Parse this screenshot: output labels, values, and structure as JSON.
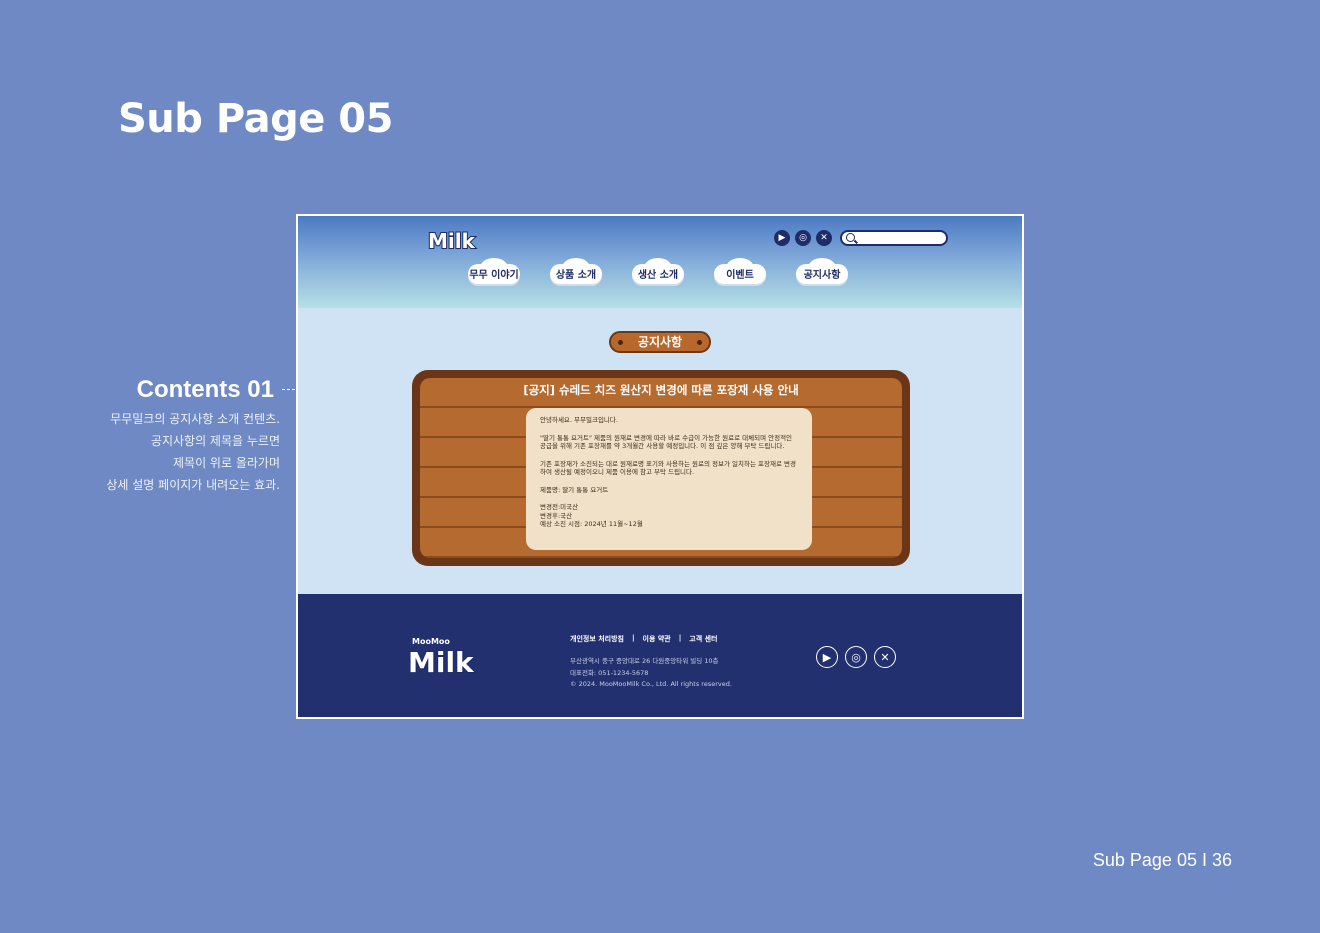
{
  "page": {
    "title": "Sub Page 05",
    "footer_label": "Sub Page 05 I 36"
  },
  "annotation": {
    "title": "Contents 01",
    "lines": [
      "무무밀크의 공지사항 소개 컨텐츠.",
      "공지사항의 제목을 누르면",
      "제목이 위로 올라가며",
      "상세 설명 페이지가 내려오는 효과."
    ]
  },
  "site": {
    "logo_text": "Milk",
    "nav": [
      "무무 이야기",
      "상품 소개",
      "생산 소개",
      "이벤트",
      "공지사항"
    ],
    "search_placeholder": "",
    "social": [
      "youtube-icon",
      "instagram-icon",
      "x-icon"
    ]
  },
  "notice": {
    "sign": "공지사항",
    "title": "[공지] 슈레드 치즈 원산지 변경에 따른 포장재 사용 안내",
    "greeting": "안녕하세요. 무무밀크입니다.",
    "para1": "\"딸기 통통 요거트\" 제품의 원재료 변경에 따라 바로 수급이 가능한 원료로 대체되며 안정적인 공급을 위해 기존 포장재를 약 3개월간 사용할 예정입니다. 이 점 깊은 양해 부탁 드립니다.",
    "para2": "기존 포장재가 소진되는 대로 원재료명 표기와 사용하는 원료의 정보가 일치하는 포장재로 변경하여 생산될 예정이오니 제품 이용에 참고 부탁 드립니다.",
    "product": "제품명: 딸기 통통 요거트",
    "before": "변경전:미국산",
    "after": "변경후:국산",
    "period": "예상 소진 시점: 2024년 11월~12월"
  },
  "footer": {
    "logo_top": "MooMoo",
    "logo_text": "Milk",
    "links": [
      "개인정보 처리방침",
      "|",
      "이용 약관",
      "|",
      "고객 센터"
    ],
    "address": "부산광역시 중구 중앙대로 26 다원중앙타워 빌딩 10층",
    "phone": "대표전화: 051-1234-5678",
    "copyright": "© 2024. MooMooMilk Co., Ltd. All rights reserved."
  },
  "colors": {
    "background": "#6f89c4",
    "footer": "#22306f",
    "wood": "#b56a30",
    "paper": "#f1e1c8"
  }
}
